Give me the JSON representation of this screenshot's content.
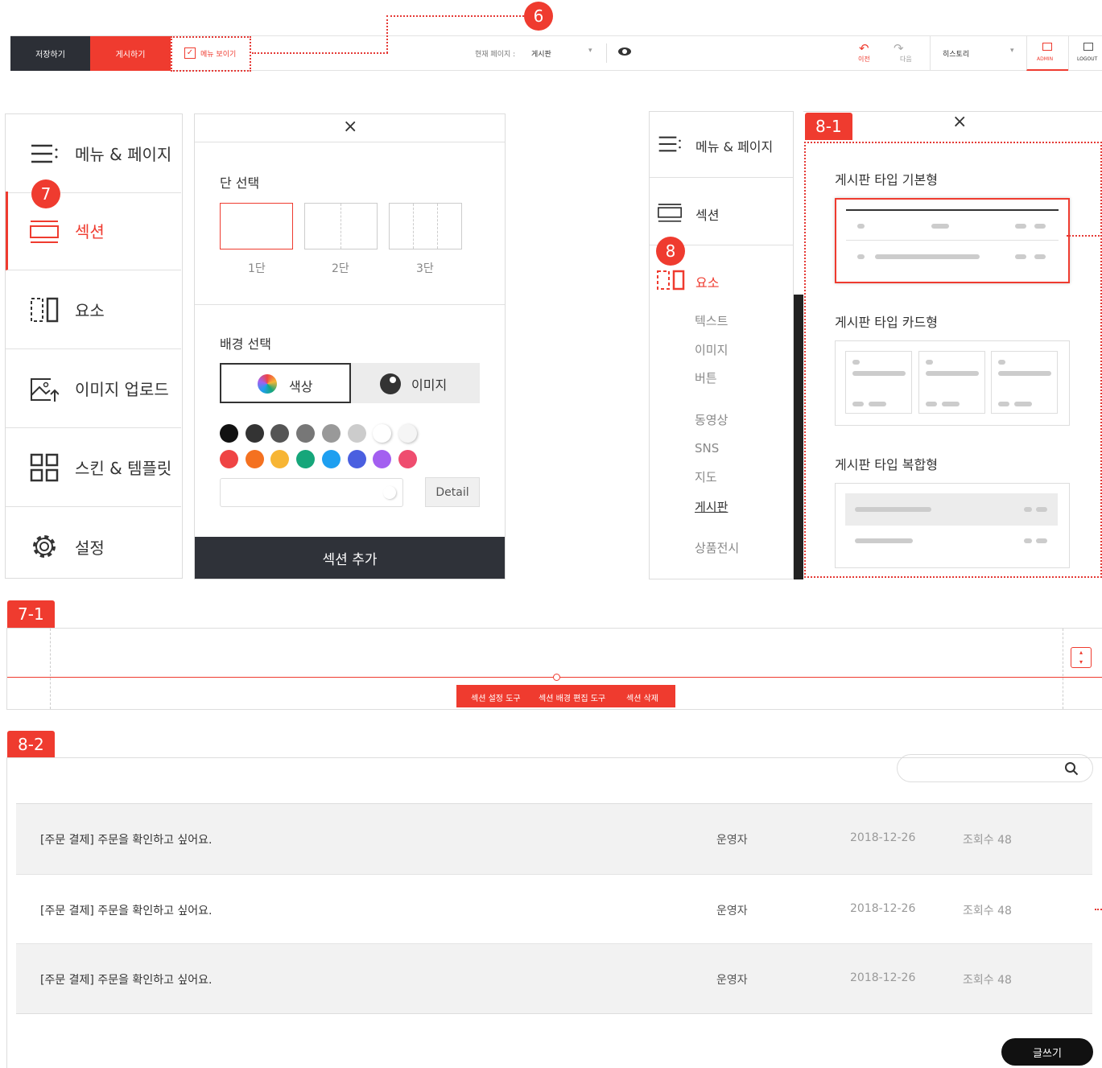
{
  "toolbar": {
    "save": "저장하기",
    "publish": "게시하기",
    "menu_toggle": "메뉴 보이기",
    "current_page_label": "현재 페이지 :",
    "current_page": "게시판",
    "undo": "이전",
    "redo": "다음",
    "history": "히스토리",
    "admin": "ADMIN",
    "logout": "LOGOUT"
  },
  "badges": {
    "b6": "6",
    "b7": "7",
    "b8": "8",
    "t81": "8-1",
    "t71": "7-1",
    "t82": "8-2"
  },
  "sidebar": {
    "items": [
      {
        "label": "메뉴 & 페이지",
        "icon": "menu-icon"
      },
      {
        "label": "섹션",
        "icon": "section-icon"
      },
      {
        "label": "요소",
        "icon": "element-icon"
      },
      {
        "label": "이미지 업로드",
        "icon": "image-upload-icon"
      },
      {
        "label": "스킨 & 템플릿",
        "icon": "grid-icon"
      },
      {
        "label": "설정",
        "icon": "gear-icon"
      }
    ]
  },
  "section_panel": {
    "col_title": "단 선택",
    "cols": [
      "1단",
      "2단",
      "3단"
    ],
    "bg_title": "배경 선택",
    "bg_color": "색상",
    "bg_image": "이미지",
    "detail": "Detail",
    "add": "섹션 추가",
    "colors": [
      "#111111",
      "#333333",
      "#555555",
      "#777777",
      "#999999",
      "#cccccc",
      "#ffffff",
      "#f5f5f5",
      "#ef4444",
      "#f47120",
      "#f7b534",
      "#16a67a",
      "#1e9ff0",
      "#4a5fe0",
      "#a35ff0",
      "#ef4d6f"
    ]
  },
  "sidebar2": {
    "items": [
      {
        "label": "메뉴 & 페이지"
      },
      {
        "label": "섹션"
      },
      {
        "label": "요소"
      }
    ],
    "subitems": [
      "텍스트",
      "이미지",
      "버튼",
      "동영상",
      "SNS",
      "지도",
      "게시판",
      "상품전시"
    ]
  },
  "board_panel": {
    "basic": "게시판 타입 기본형",
    "card": "게시판 타입 카드형",
    "mixed": "게시판 타입 복합형"
  },
  "section_tools": [
    "섹션 설정 도구",
    "섹션 배경 편집 도구",
    "섹션 삭제"
  ],
  "board": {
    "rows": [
      {
        "title": "[주문 결제] 주문을 확인하고 싶어요.",
        "author": "운영자",
        "date": "2018-12-26",
        "views": "조회수 48"
      },
      {
        "title": "[주문 결제] 주문을 확인하고 싶어요.",
        "author": "운영자",
        "date": "2018-12-26",
        "views": "조회수 48"
      },
      {
        "title": "[주문 결제] 주문을 확인하고 싶어요.",
        "author": "운영자",
        "date": "2018-12-26",
        "views": "조회수 48"
      }
    ],
    "write": "글쓰기"
  }
}
